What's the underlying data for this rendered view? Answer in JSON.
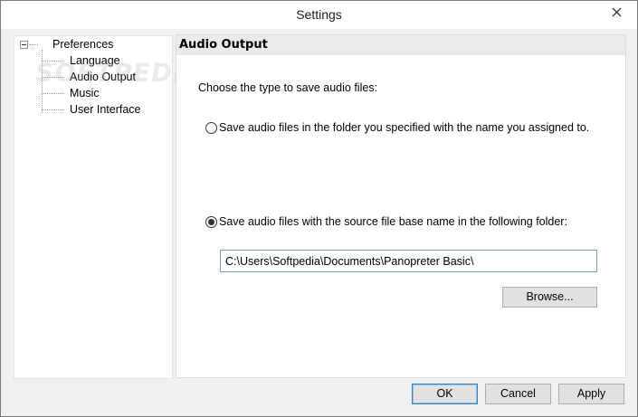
{
  "window": {
    "title": "Settings"
  },
  "tree": {
    "root": "Preferences",
    "items": [
      {
        "label": "Language"
      },
      {
        "label": "Audio Output"
      },
      {
        "label": "Music"
      },
      {
        "label": "User Interface"
      }
    ]
  },
  "panel": {
    "header": "Audio Output",
    "prompt": "Choose the type to save audio files:",
    "option1": {
      "label": "Save audio files in the folder you specified with the name you assigned to.",
      "checked": false
    },
    "option2": {
      "label": "Save audio files with the source file base name in the following folder:",
      "checked": true
    },
    "folder_path": "C:\\Users\\Softpedia\\Documents\\Panopreter Basic\\",
    "browse_label": "Browse..."
  },
  "buttons": {
    "ok": "OK",
    "cancel": "Cancel",
    "apply": "Apply"
  },
  "watermark": "SOFTPEDIA"
}
